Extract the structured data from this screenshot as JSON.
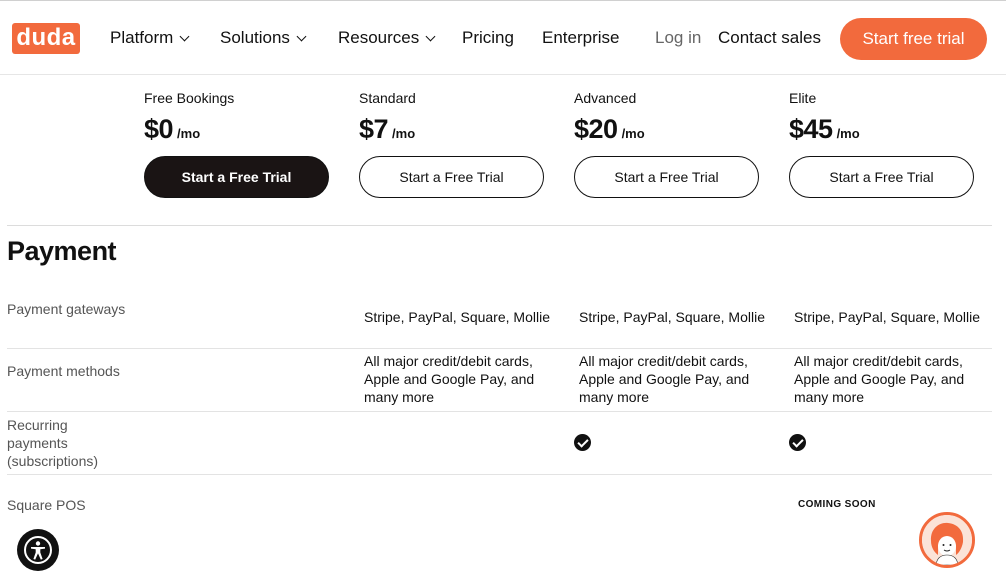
{
  "nav": {
    "logo": "duda",
    "items": [
      {
        "label": "Platform",
        "dropdown": true
      },
      {
        "label": "Solutions",
        "dropdown": true
      },
      {
        "label": "Resources",
        "dropdown": true
      },
      {
        "label": "Pricing",
        "dropdown": false
      },
      {
        "label": "Enterprise",
        "dropdown": false
      }
    ],
    "login": "Log in",
    "contact": "Contact sales",
    "cta": "Start free trial"
  },
  "plans": [
    {
      "name": "Free Bookings",
      "price": "$0",
      "per": "/mo",
      "button": "Start a Free Trial"
    },
    {
      "name": "Standard",
      "price": "$7",
      "per": "/mo",
      "button": "Start a Free Trial"
    },
    {
      "name": "Advanced",
      "price": "$20",
      "per": "/mo",
      "button": "Start a Free Trial"
    },
    {
      "name": "Elite",
      "price": "$45",
      "per": "/mo",
      "button": "Start a Free Trial"
    }
  ],
  "section": {
    "title": "Payment",
    "rows": [
      {
        "label": "Payment gateways",
        "cells": [
          "",
          "Stripe, PayPal, Square, Mollie",
          "Stripe, PayPal, Square, Mollie",
          "Stripe, PayPal, Square, Mollie"
        ]
      },
      {
        "label": "Payment methods",
        "cells": [
          "",
          "All major credit/debit cards, Apple and Google Pay, and many more",
          "All major credit/debit cards, Apple and Google Pay, and many more",
          "All major credit/debit cards, Apple and Google Pay, and many more"
        ]
      },
      {
        "label": "Recurring payments (subscriptions)",
        "checks": [
          false,
          false,
          true,
          true
        ]
      },
      {
        "label": "Square POS",
        "badge": "COMING SOON"
      }
    ]
  },
  "colors": {
    "brand": "#f26a3d",
    "dark": "#1a1414"
  },
  "icons": {
    "accessibility": "accessibility-icon",
    "chat": "chat-avatar-icon",
    "check": "check-circle-icon"
  }
}
